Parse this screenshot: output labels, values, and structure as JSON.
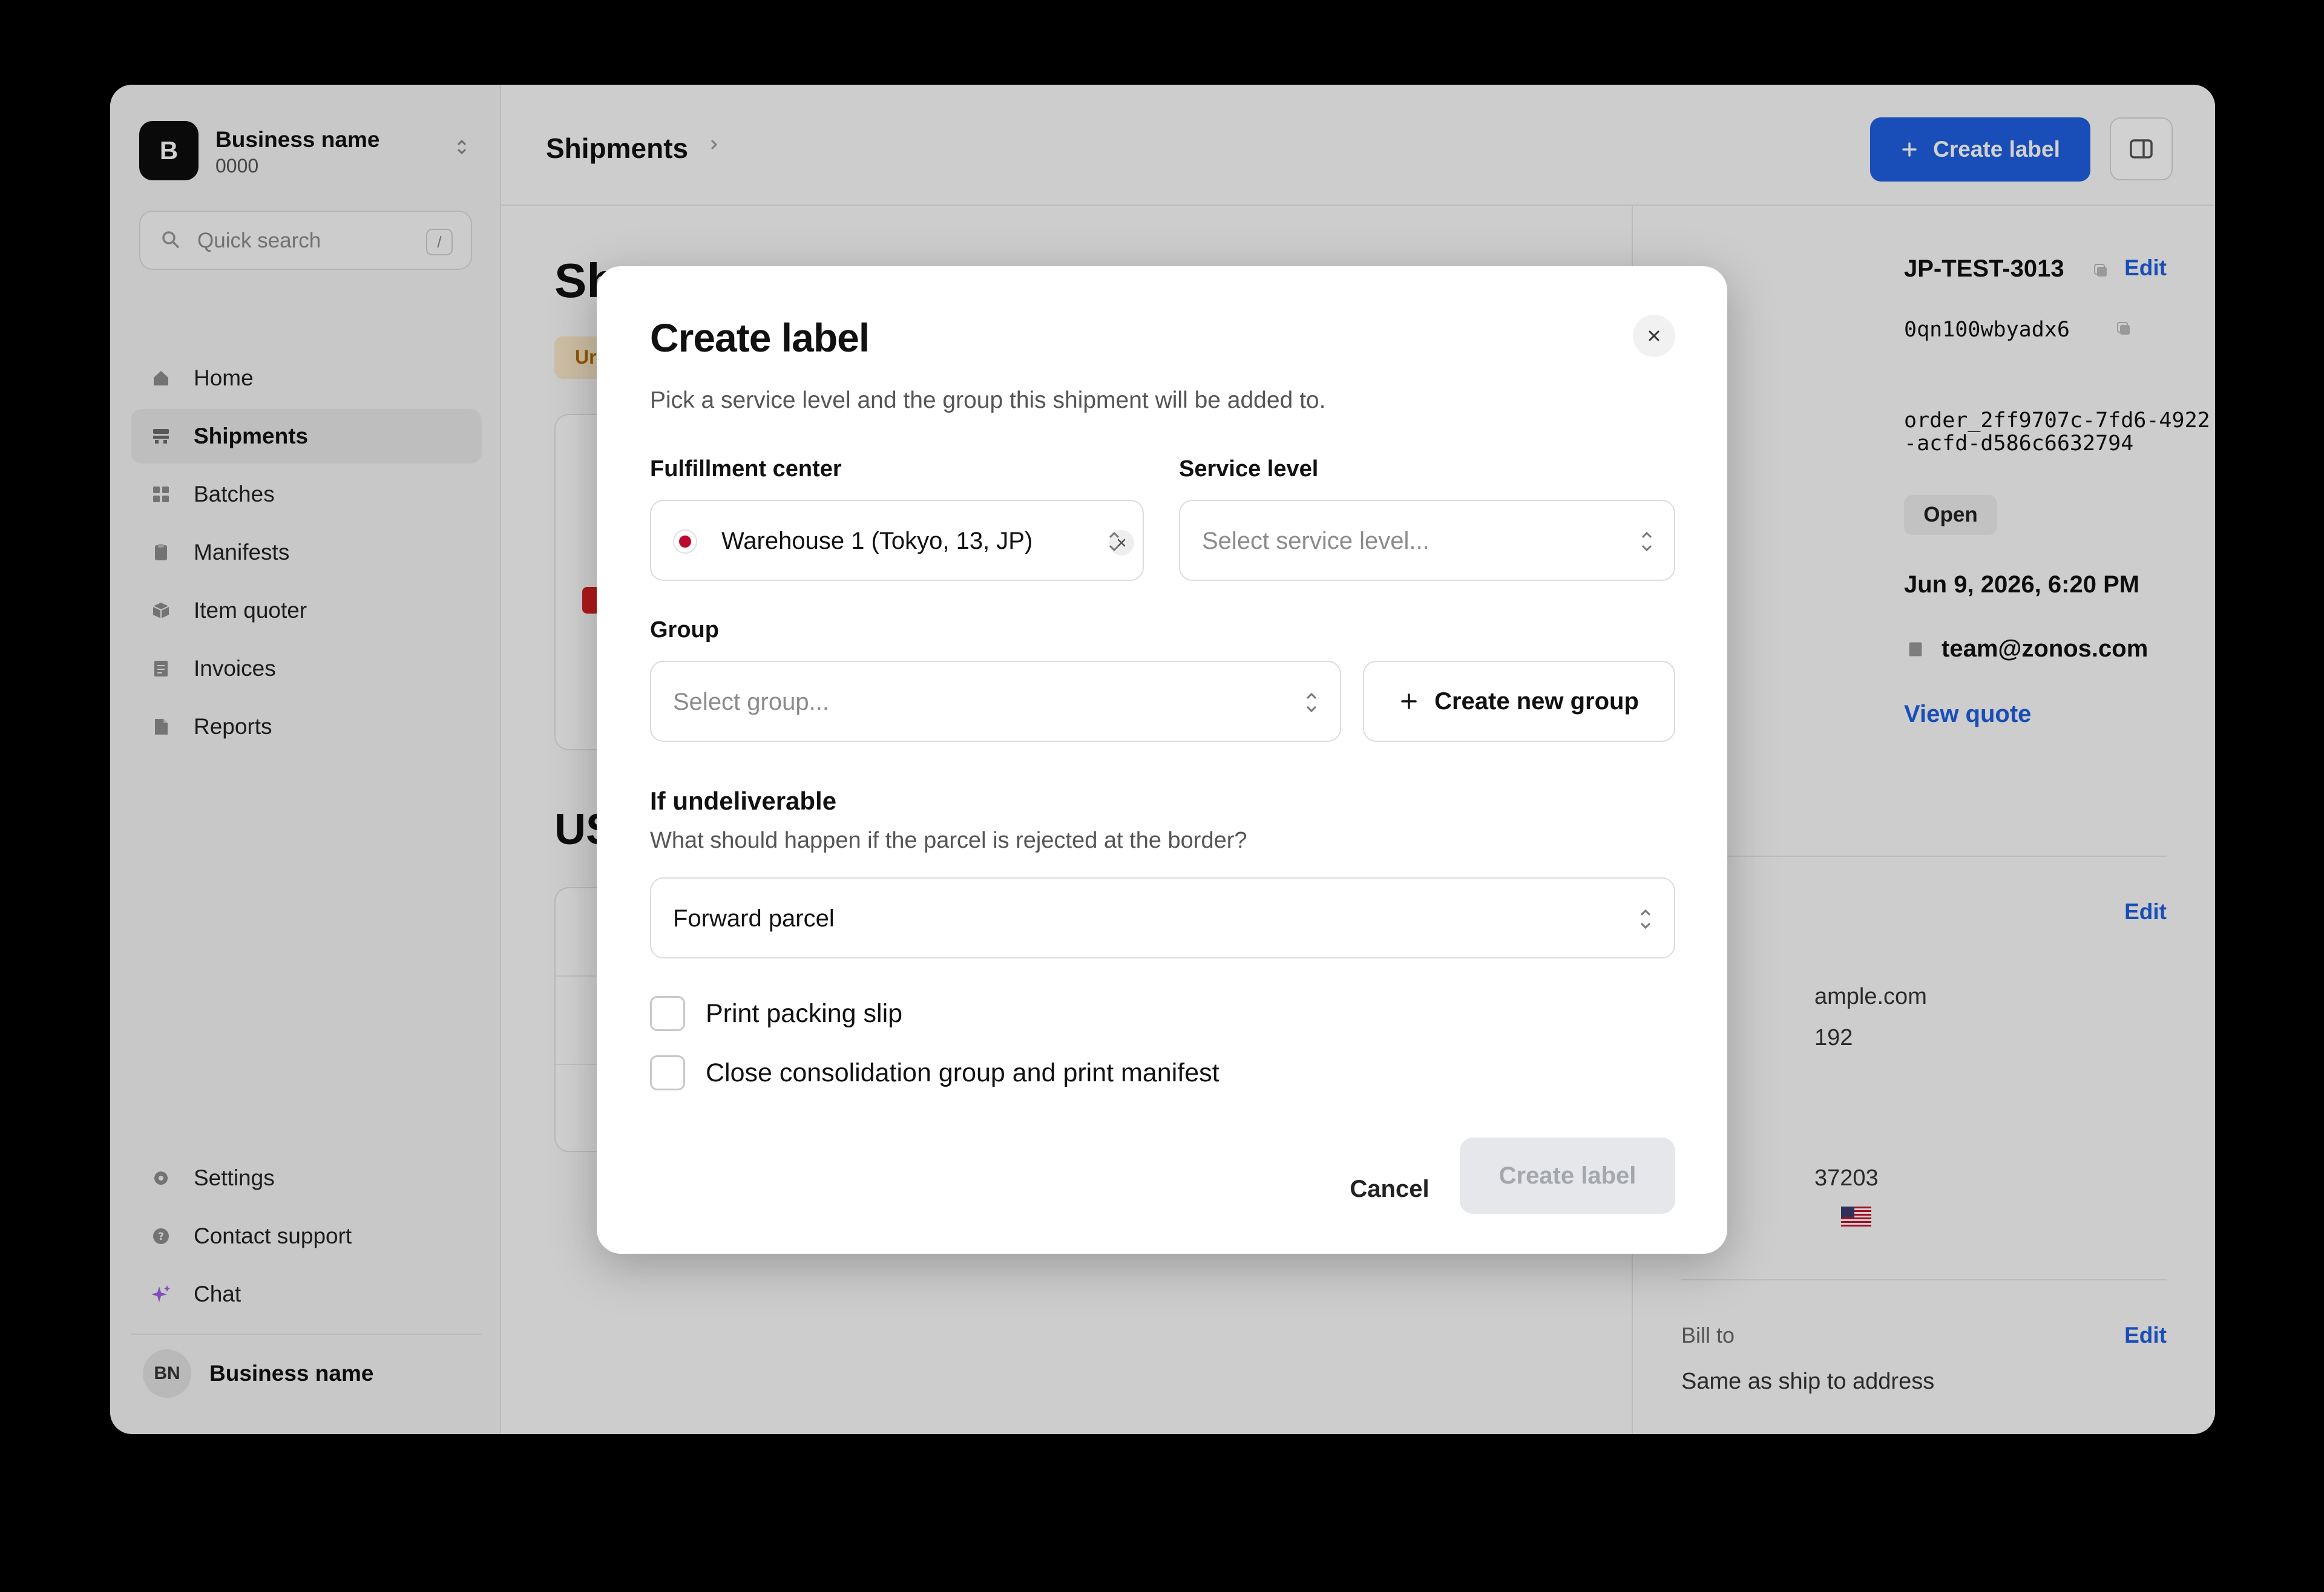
{
  "sidebar": {
    "business": {
      "logo_letter": "B",
      "name": "Business name",
      "id": "0000"
    },
    "search": {
      "placeholder": "Quick search",
      "shortcut": "/"
    },
    "nav_items": [
      {
        "label": "Home",
        "icon": "home-icon"
      },
      {
        "label": "Shipments",
        "icon": "truck-icon",
        "active": true
      },
      {
        "label": "Batches",
        "icon": "grid-icon"
      },
      {
        "label": "Manifests",
        "icon": "clipboard-icon"
      },
      {
        "label": "Item quoter",
        "icon": "box-icon"
      },
      {
        "label": "Invoices",
        "icon": "invoice-icon"
      },
      {
        "label": "Reports",
        "icon": "document-icon"
      }
    ],
    "bottom_items": [
      {
        "label": "Settings",
        "icon": "gear-icon"
      },
      {
        "label": "Contact support",
        "icon": "help-icon"
      },
      {
        "label": "Chat",
        "icon": "sparkle-icon",
        "icon_color": "#9b5de5"
      }
    ],
    "user": {
      "initials": "BN",
      "name": "Business name"
    }
  },
  "header": {
    "title": "Shipments",
    "create_label_button": "Create label"
  },
  "background": {
    "title_fragment": "Sh",
    "badge_fragment": "Ur",
    "section_fragment": "US"
  },
  "details": {
    "order_number": "JP-TEST-3013",
    "short_id": "0qn100wbyadx6",
    "order_id_line1": "order_2ff9707c-7fd6-4922",
    "order_id_line2": "-acfd-d586c6632794",
    "status": "Open",
    "created": "Jun 9, 2026, 6:20 PM",
    "email": "team@zonos.com",
    "view_quote": "View quote",
    "edit_label": "Edit",
    "email_fragment": "ample.com",
    "phone_fragment": "192",
    "zip_fragment": "37203",
    "bill_to_fragment": "Bill to",
    "bill_to_value": "Same as ship to address"
  },
  "modal": {
    "title": "Create label",
    "description": "Pick a service level and the group this shipment will be added to.",
    "fulfillment_center": {
      "label": "Fulfillment center",
      "value": "Warehouse 1 (Tokyo, 13, JP)"
    },
    "service_level": {
      "label": "Service level",
      "placeholder": "Select service level..."
    },
    "group": {
      "label": "Group",
      "placeholder": "Select group...",
      "create_button": "Create new group"
    },
    "undeliverable": {
      "title": "If undeliverable",
      "description": "What should happen if the parcel is rejected at the border?",
      "value": "Forward parcel"
    },
    "checkboxes": [
      {
        "label": "Print packing slip",
        "checked": false
      },
      {
        "label": "Close consolidation group and print manifest",
        "checked": false
      }
    ],
    "cancel_button": "Cancel",
    "submit_button": "Create label"
  },
  "colors": {
    "accent": "#1f5fe0",
    "brand_dark": "#0d0d0d",
    "disabled_bg": "#e6e7ea",
    "disabled_text": "#a4a7ad"
  }
}
